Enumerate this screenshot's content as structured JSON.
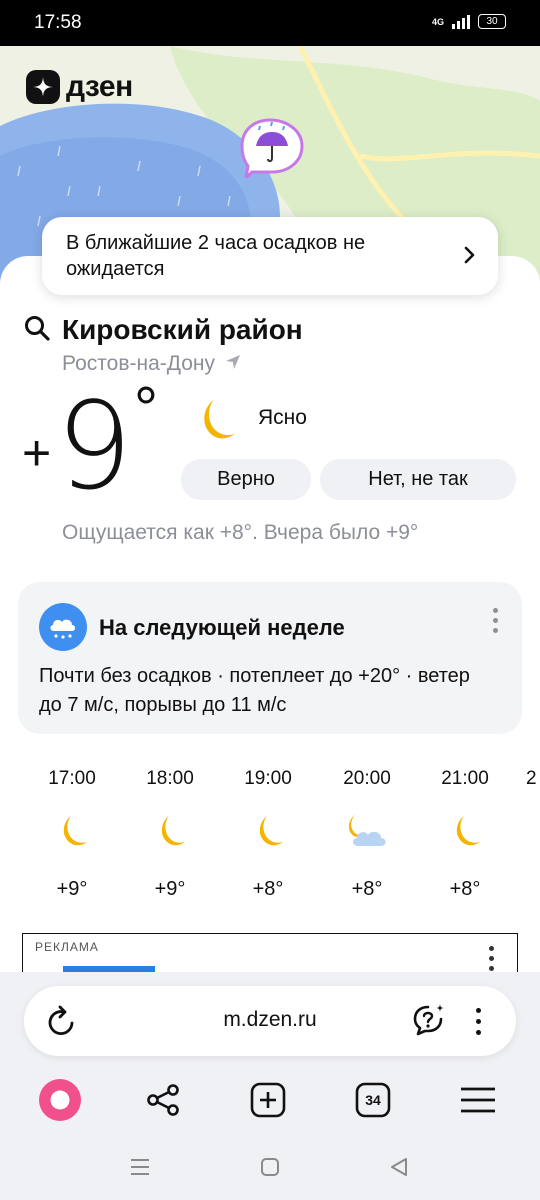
{
  "status_bar": {
    "time": "17:58",
    "network": "4G",
    "battery": "30"
  },
  "app": {
    "logo_text": "дзен"
  },
  "nowcast": {
    "text": "В ближайшие 2 часа осадков не ожидается"
  },
  "location": {
    "title": "Кировский район",
    "city": "Ростов-на-Дону"
  },
  "current": {
    "sign": "+",
    "temp": "9",
    "degree": "°",
    "condition": "Ясно",
    "confirm_label": "Верно",
    "reject_label": "Нет, не так",
    "feels_like": "Ощущается как +8°. Вчера было +9°"
  },
  "week": {
    "title": "На следующей неделе",
    "text": "Почти без осадков · потеплеет до +20° · ветер до 7 м/с, порывы до 11 м/с"
  },
  "hourly": [
    {
      "time": "17:00",
      "icon": "moon-icon",
      "temp": "+9°"
    },
    {
      "time": "18:00",
      "icon": "moon-icon",
      "temp": "+9°"
    },
    {
      "time": "19:00",
      "icon": "moon-icon",
      "temp": "+8°"
    },
    {
      "time": "20:00",
      "icon": "moon-cloud-icon",
      "temp": "+8°"
    },
    {
      "time": "21:00",
      "icon": "moon-icon",
      "temp": "+8°"
    },
    {
      "time": "2",
      "icon": "",
      "temp": ""
    }
  ],
  "ad": {
    "label": "РЕКЛАМА"
  },
  "browser": {
    "url": "m.dzen.ru",
    "tabs_count": "34"
  },
  "colors": {
    "accent_blue": "#3f8ff0",
    "alice_pink": "#f0508c",
    "moon_yellow": "#f5b400"
  }
}
